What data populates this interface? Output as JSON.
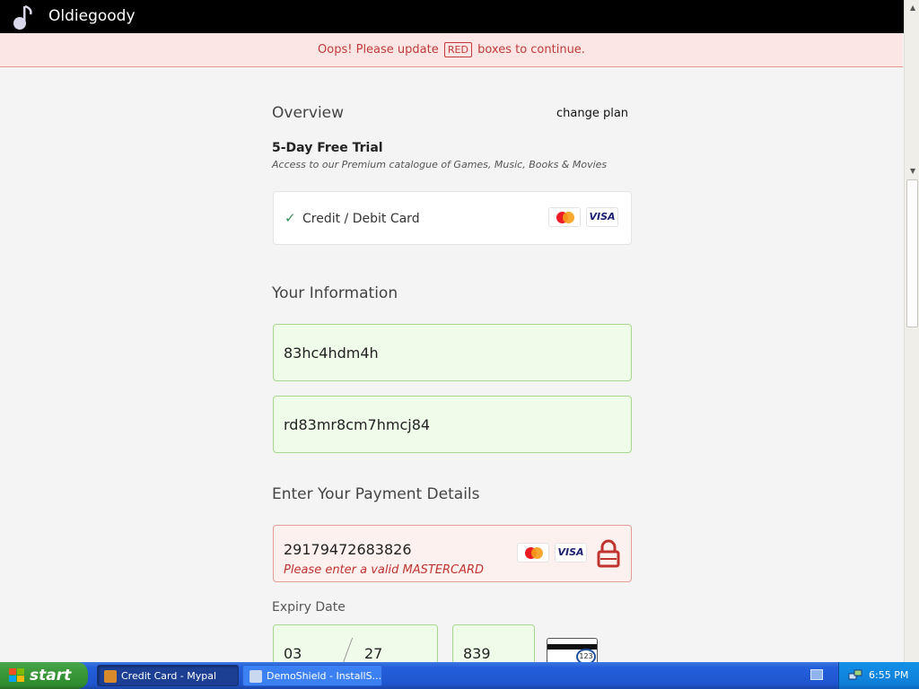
{
  "topbar": {
    "brand": "Oldiegoody",
    "logo_icon": "music-note-icon"
  },
  "banner": {
    "prefix": "Oops! Please update",
    "highlight": "RED",
    "suffix": "boxes to continue."
  },
  "overview": {
    "title": "Overview",
    "change_plan": "change plan",
    "plan_name": "5-Day Free Trial",
    "plan_desc": "Access to our Premium catalogue of Games, Music, Books & Movies",
    "payment_option": {
      "label": "Credit / Debit Card",
      "check": "✓"
    }
  },
  "info": {
    "title": "Your Information",
    "field1_value": "83hc4hdm4h",
    "field2_value": "rd83mr8cm7hmcj84"
  },
  "payment": {
    "title": "Enter Your Payment Details",
    "card_number": "29179472683826",
    "card_error": "Please enter a valid MASTERCARD",
    "visa_label": "VISA",
    "expiry_label": "Expiry Date",
    "expiry_month": "03",
    "expiry_year": "27",
    "cvv": "839",
    "cvv_hint": "123"
  },
  "taskbar": {
    "start_label": "start",
    "tasks": [
      {
        "label": "Credit Card - Mypal",
        "active": true
      },
      {
        "label": "DemoShield - InstallS...",
        "active": false
      }
    ],
    "time": "6:55 PM"
  },
  "colors": {
    "error": "#c0332e",
    "valid_bg": "#f0fcea",
    "valid_border": "#a7d88f",
    "error_bg": "#fdf1f0"
  }
}
